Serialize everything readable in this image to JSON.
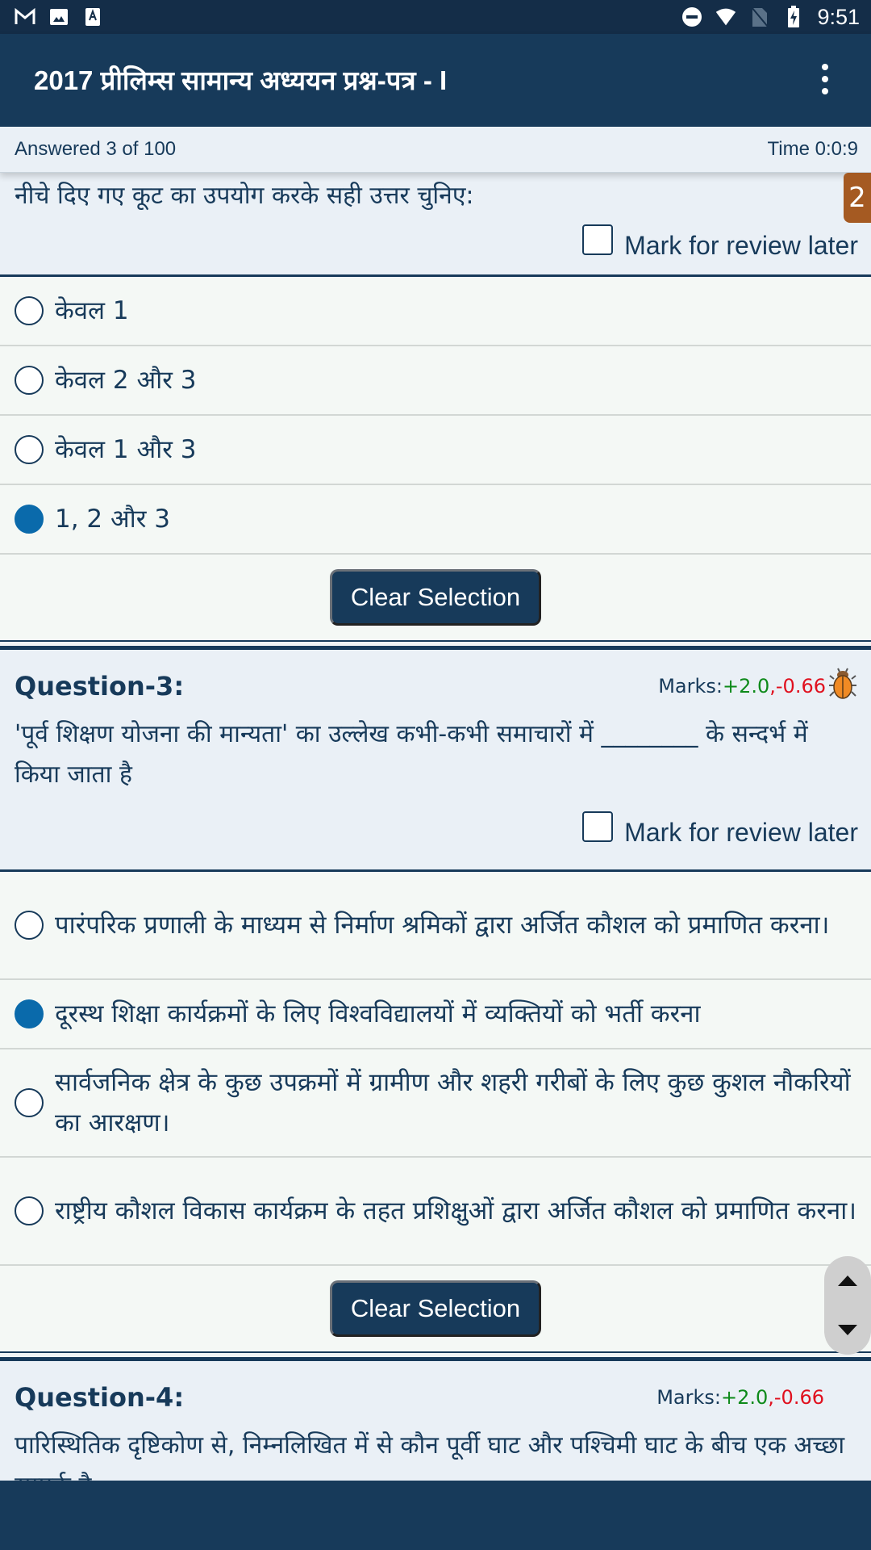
{
  "status_bar": {
    "left_icons": [
      "gmail-icon",
      "image-icon",
      "font-icon"
    ],
    "right_icons": [
      "do-not-disturb-icon",
      "wifi-icon",
      "no-sim-icon",
      "battery-charging-icon"
    ],
    "time": "9:51"
  },
  "app_bar": {
    "title": "2017 प्रीलिम्स सामान्य अध्ययन प्रश्न-पत्र - I",
    "menu_icon": "more-vert-icon"
  },
  "progress": {
    "answered": "Answered 3 of 100",
    "time": "Time 0:0:9"
  },
  "question_badge": "2",
  "questions": [
    {
      "text": "नीचे दिए गए कूट का उपयोग करके सही उत्तर चुनिए:",
      "review_label": "Mark for review later",
      "review_checked": false,
      "options": [
        {
          "text": "केवल 1",
          "selected": false
        },
        {
          "text": "केवल 2 और 3",
          "selected": false
        },
        {
          "text": "केवल 1 और 3",
          "selected": false
        },
        {
          "text": "1, 2 और 3",
          "selected": true
        }
      ],
      "clear_label": "Clear Selection"
    },
    {
      "title": "Question-3:",
      "marks_label": "Marks:",
      "marks_pos": "+2.0",
      "marks_sep": ",",
      "marks_neg": "-0.66",
      "report_icon": "bug-icon",
      "text": "'पूर्व शिक्षण योजना की मान्यता' का उल्लेख कभी-कभी समाचारों में ________ के सन्दर्भ में किया जाता है",
      "review_label": "Mark for review later",
      "review_checked": false,
      "options": [
        {
          "text": "पारंपरिक प्रणाली के माध्यम से निर्माण श्रमिकों द्वारा अर्जित कौशल को प्रमाणित करना।",
          "selected": false
        },
        {
          "text": "दूरस्थ शिक्षा कार्यक्रमों के लिए विश्वविद्यालयों में व्यक्तियों को भर्ती करना",
          "selected": true
        },
        {
          "text": "सार्वजनिक क्षेत्र के कुछ उपक्रमों में ग्रामीण और शहरी गरीबों के लिए कुछ कुशल नौकरियों का आरक्षण।",
          "selected": false
        },
        {
          "text": "राष्ट्रीय कौशल विकास कार्यक्रम के तहत प्रशिक्षुओं द्वारा अर्जित कौशल को प्रमाणित करना।",
          "selected": false
        }
      ],
      "clear_label": "Clear Selection"
    },
    {
      "title": "Question-4:",
      "marks_label": "Marks:",
      "marks_pos": "+2.0",
      "marks_sep": ",",
      "marks_neg": "-0.66",
      "text": "पारिस्थितिक दृष्टिकोण से, निम्नलिखित में से कौन पूर्वी घाट और पश्चिमी घाट के बीच एक अच्छा सम्पर्क है"
    }
  ],
  "scroll_controls": {
    "up_icon": "scroll-up-icon",
    "down_icon": "scroll-down-icon"
  }
}
